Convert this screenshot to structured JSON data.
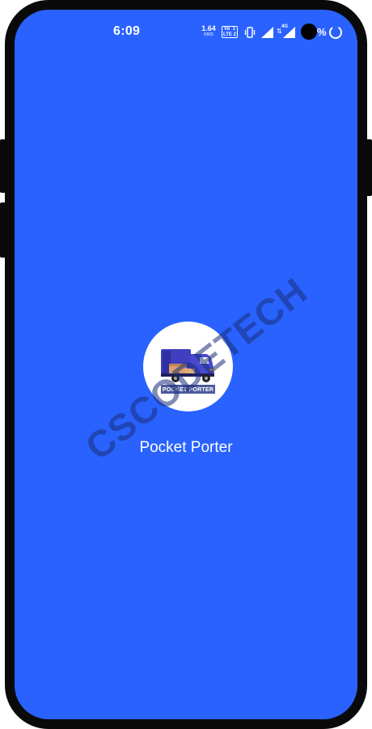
{
  "status_bar": {
    "time": "6:09",
    "net_speed_value": "1.64",
    "net_speed_unit": "KB/S",
    "volte_top": "Vo  1",
    "volte_bottom": "LTE 2",
    "network_type": "4G",
    "battery_symbol": "%",
    "icons": [
      "vibrate-icon",
      "signal-icon",
      "data-arrows-icon",
      "signal-icon",
      "battery-charging-icon"
    ]
  },
  "splash": {
    "logo_caption": "POCKET PORTER",
    "app_name": "Pocket Porter",
    "logo_icon": "delivery-truck-icon"
  },
  "watermark": {
    "text": "CSCODETECH"
  },
  "colors": {
    "background": "#2962ff",
    "frame": "#0a0a0a",
    "logo_bg": "#ffffff",
    "truck_body": "#3f3fc0",
    "box": "#d9a06a",
    "watermark": "#1d2d78"
  }
}
